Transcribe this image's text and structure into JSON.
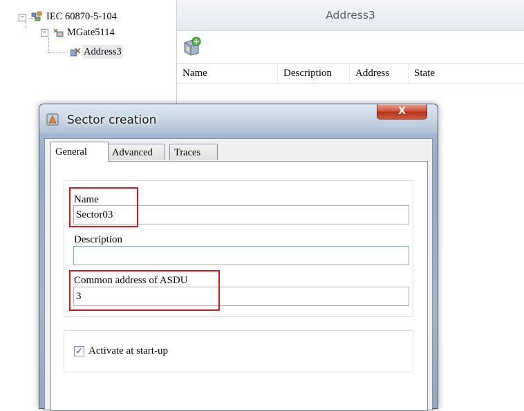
{
  "tree": {
    "items": [
      {
        "label": "IEC 60870-5-104",
        "expander": "−",
        "icon": "network-icon"
      },
      {
        "label": "MGate5114",
        "expander": "−",
        "icon": "device-icon"
      },
      {
        "label": "Address3",
        "icon": "address-icon"
      }
    ]
  },
  "panel": {
    "title": "Address3",
    "toolbar": {
      "add_icon": "add-sector-icon"
    },
    "columns": [
      "Name",
      "Description",
      "Address",
      "State"
    ]
  },
  "dialog": {
    "title": "Sector creation",
    "close_label": "X",
    "tabs": [
      "General",
      "Advanced",
      "Traces"
    ],
    "active_tab": "General",
    "fields": {
      "name": {
        "label": "Name",
        "value": "Sector03"
      },
      "description": {
        "label": "Description",
        "value": ""
      },
      "asdu": {
        "label": "Common address of ASDU",
        "value": "3"
      }
    },
    "activate": {
      "label": "Activate at start-up",
      "checked": true,
      "check_glyph": "✓"
    }
  },
  "colors": {
    "highlight_box": "#e0141e",
    "close_button": "#c8452c",
    "dialog_frame": "#a3b8d1"
  }
}
